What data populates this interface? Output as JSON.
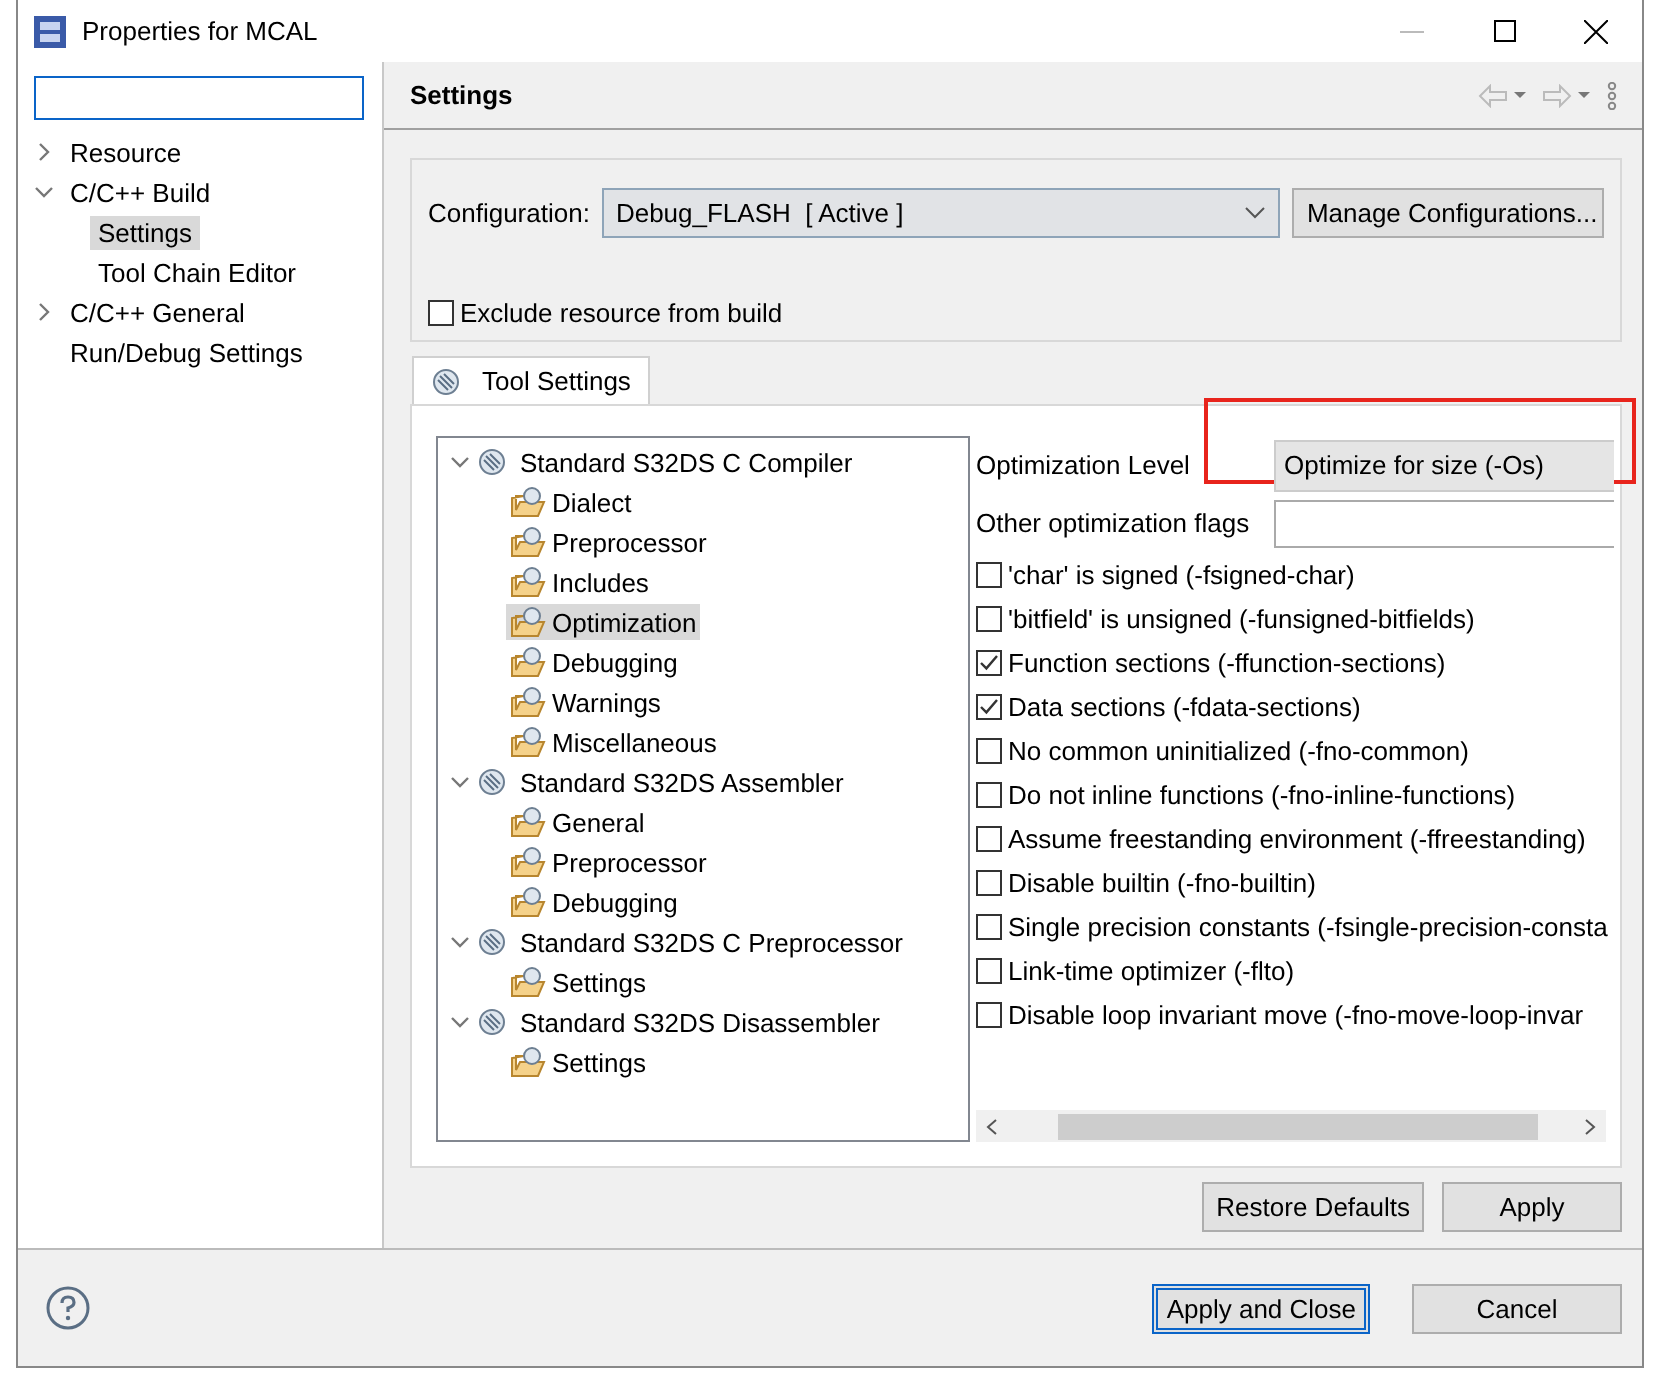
{
  "window": {
    "title": "Properties for MCAL"
  },
  "sidebar": {
    "items": [
      {
        "label": "Resource",
        "expanded": false,
        "selected": false
      },
      {
        "label": "C/C++ Build",
        "expanded": true,
        "selected": false,
        "children": [
          {
            "label": "Settings",
            "selected": true
          },
          {
            "label": "Tool Chain Editor",
            "selected": false
          }
        ]
      },
      {
        "label": "C/C++ General",
        "expanded": false,
        "selected": false
      },
      {
        "label": "Run/Debug Settings",
        "selected": false
      }
    ]
  },
  "page": {
    "title": "Settings",
    "configuration": {
      "label": "Configuration:",
      "value": "Debug_FLASH  [ Active ]",
      "button": "Manage Configurations..."
    },
    "exclude": {
      "label": "Exclude resource from build",
      "checked": false
    },
    "tabs": [
      {
        "label": "Tool Settings",
        "selected": true
      }
    ],
    "tool_tree": [
      {
        "label": "Standard S32DS C Compiler",
        "expanded": true,
        "children": [
          {
            "label": "Dialect",
            "selected": false
          },
          {
            "label": "Preprocessor",
            "selected": false
          },
          {
            "label": "Includes",
            "selected": false
          },
          {
            "label": "Optimization",
            "selected": true
          },
          {
            "label": "Debugging",
            "selected": false
          },
          {
            "label": "Warnings",
            "selected": false
          },
          {
            "label": "Miscellaneous",
            "selected": false
          }
        ]
      },
      {
        "label": "Standard S32DS Assembler",
        "expanded": true,
        "children": [
          {
            "label": "General",
            "selected": false
          },
          {
            "label": "Preprocessor",
            "selected": false
          },
          {
            "label": "Debugging",
            "selected": false
          }
        ]
      },
      {
        "label": "Standard S32DS C Preprocessor",
        "expanded": true,
        "children": [
          {
            "label": "Settings",
            "selected": false
          }
        ]
      },
      {
        "label": "Standard S32DS Disassembler",
        "expanded": true,
        "children": [
          {
            "label": "Settings",
            "selected": false
          }
        ]
      }
    ],
    "options": {
      "level": {
        "label": "Optimization Level",
        "value": "Optimize for size (-Os)",
        "highlighted": true
      },
      "flags": {
        "label": "Other optimization flags"
      },
      "checks": [
        {
          "label": "'char' is signed (-fsigned-char)",
          "checked": false
        },
        {
          "label": "'bitfield' is unsigned (-funsigned-bitfields)",
          "checked": false
        },
        {
          "label": "Function sections (-ffunction-sections)",
          "checked": true
        },
        {
          "label": "Data sections (-fdata-sections)",
          "checked": true
        },
        {
          "label": "No common uninitialized (-fno-common)",
          "checked": false
        },
        {
          "label": "Do not inline functions (-fno-inline-functions)",
          "checked": false
        },
        {
          "label": "Assume freestanding environment (-ffreestanding)",
          "checked": false
        },
        {
          "label": "Disable builtin (-fno-builtin)",
          "checked": false
        },
        {
          "label": "Single precision constants (-fsingle-precision-consta",
          "checked": false
        },
        {
          "label": "Link-time optimizer (-flto)",
          "checked": false
        },
        {
          "label": "Disable loop invariant move (-fno-move-loop-invar",
          "checked": false
        }
      ]
    },
    "buttons": [
      "Restore Defaults",
      "Apply"
    ]
  },
  "footer": {
    "buttons": [
      {
        "label": "Apply and Close",
        "default": true
      },
      {
        "label": "Cancel",
        "default": false
      }
    ]
  }
}
